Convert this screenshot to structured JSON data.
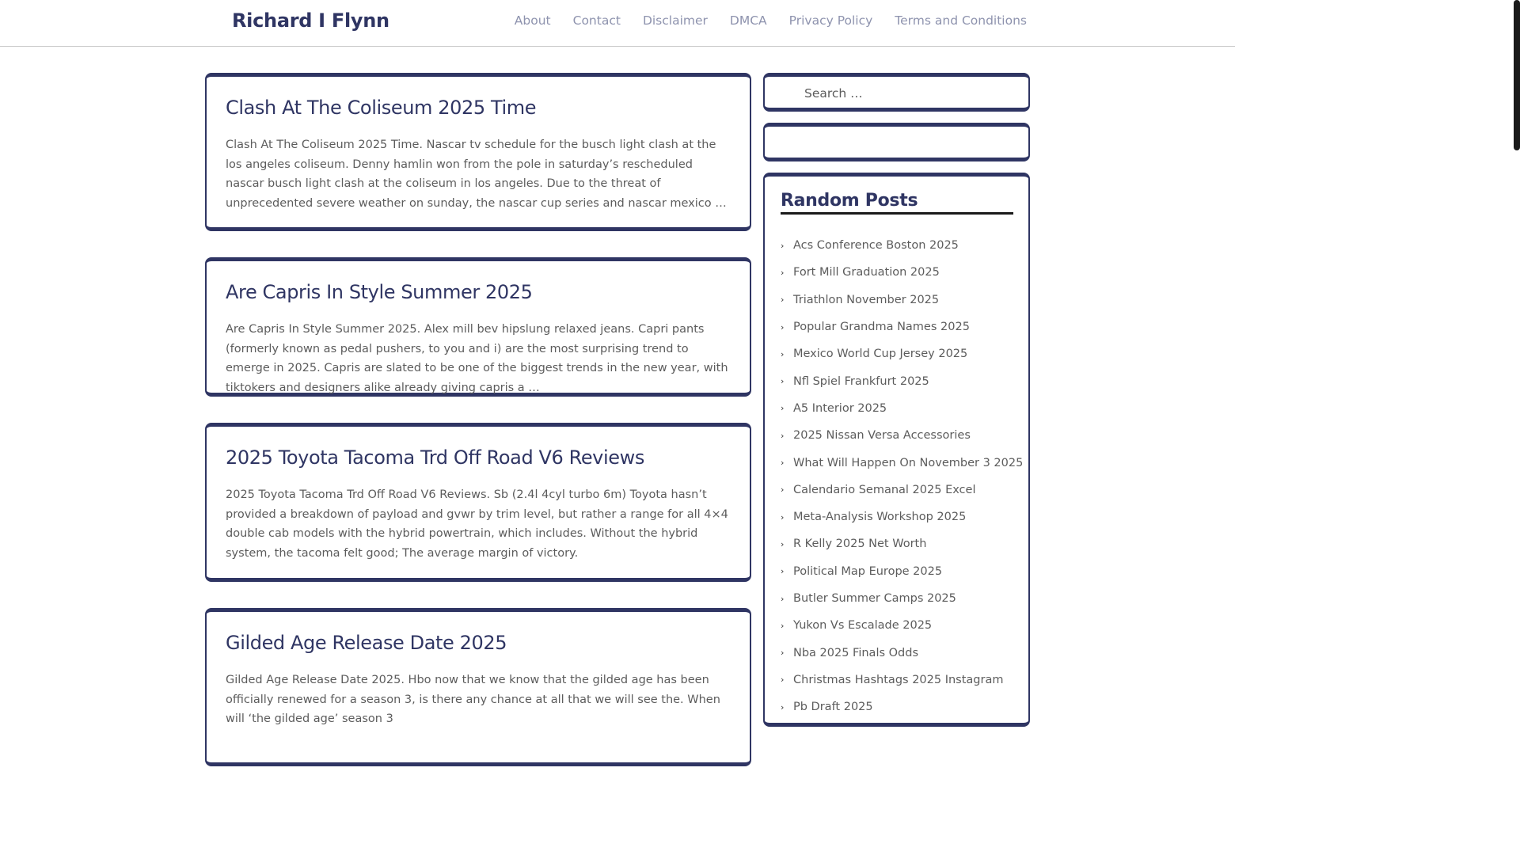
{
  "site": {
    "title": "Richard I Flynn"
  },
  "nav": [
    "About",
    "Contact",
    "Disclaimer",
    "DMCA",
    "Privacy Policy",
    "Terms and Conditions"
  ],
  "posts": [
    {
      "title": "Clash At The Coliseum 2025 Time",
      "excerpt": "Clash At The Coliseum 2025 Time. Nascar tv schedule for the busch light clash at the los angeles coliseum. Denny hamlin won from the pole in saturday’s rescheduled nascar busch light clash at the coliseum in los angeles. Due to the threat of unprecedented severe weather on sunday, the nascar cup series and nascar mexico …"
    },
    {
      "title": "Are Capris In Style Summer 2025",
      "excerpt": "Are Capris In Style Summer 2025. Alex mill bev hipslung relaxed jeans. Capri pants (formerly known as pedal pushers, to you and i) are the most surprising trend to emerge in 2025. Capris are slated to be one of the biggest trends in the new year, with tiktokers and designers alike already giving capris a …"
    },
    {
      "title": "2025 Toyota Tacoma Trd Off Road V6 Reviews",
      "excerpt": "2025 Toyota Tacoma Trd Off Road V6 Reviews. Sb (2.4l 4cyl turbo 6m) Toyota hasn’t provided a breakdown of payload and gvwr by trim level, but rather a range for all 4×4 double cab models with the hybrid powertrain, which includes. Without the hybrid system, the tacoma felt good; The average margin of victory."
    },
    {
      "title": "Gilded Age Release Date 2025",
      "excerpt": "Gilded Age Release Date 2025. Hbo now that we know that the gilded age has been officially renewed for a season 3, is there any chance at all that we will see the. When will ‘the gilded age’ season 3"
    }
  ],
  "sidebar": {
    "search_placeholder": "Search …",
    "random_title": "Random Posts",
    "random_posts": [
      "Acs Conference Boston 2025",
      "Fort Mill Graduation 2025",
      "Triathlon November 2025",
      "Popular Grandma Names 2025",
      "Mexico World Cup Jersey 2025",
      "Nfl Spiel Frankfurt 2025",
      "A5 Interior 2025",
      "2025 Nissan Versa Accessories",
      "What Will Happen On November 3 2025",
      "Calendario Semanal 2025 Excel",
      "Meta-Analysis Workshop 2025",
      "R Kelly 2025 Net Worth",
      "Political Map Europe 2025",
      "Butler Summer Camps 2025",
      "Yukon Vs Escalade 2025",
      "Nba 2025 Finals Odds",
      "Christmas Hashtags 2025 Instagram",
      "Pb Draft 2025"
    ]
  },
  "colors": {
    "accent": "#2f3563",
    "text": "#5c5c5c",
    "nav": "#8e93ae"
  }
}
